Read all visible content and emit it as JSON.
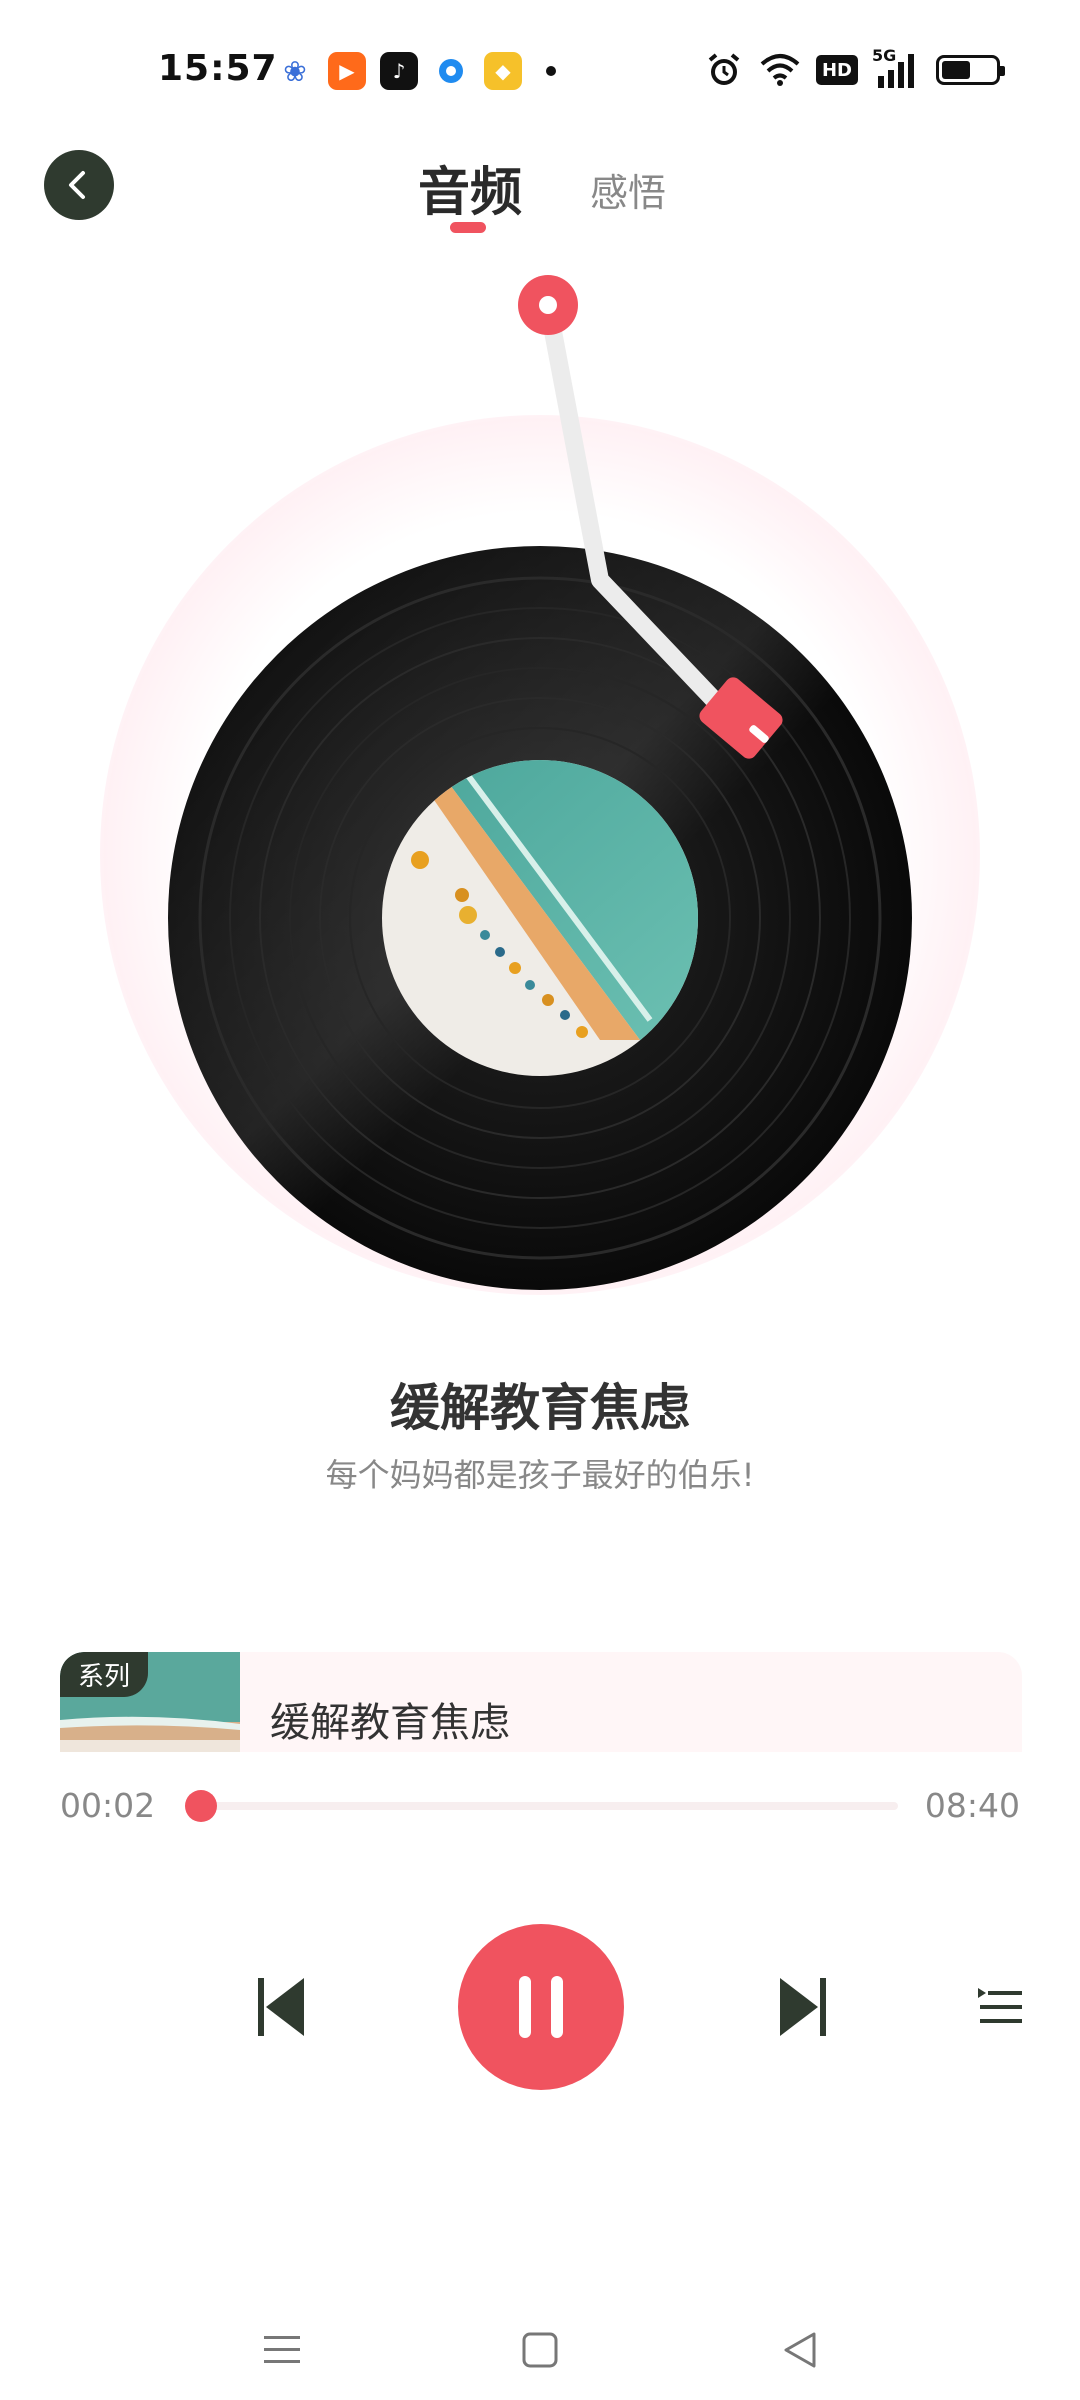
{
  "status_bar": {
    "time": "15:57",
    "network": "5G",
    "hd_label": "HD",
    "battery_level": 0.55
  },
  "header": {
    "tabs": [
      {
        "label": "音频",
        "active": true
      },
      {
        "label": "感悟",
        "active": false
      }
    ]
  },
  "track": {
    "title": "缓解教育焦虑",
    "subtitle": "每个妈妈都是孩子最好的伯乐!"
  },
  "series": {
    "tag": "系列",
    "name": "缓解教育焦虑"
  },
  "progress": {
    "current": "00:02",
    "total": "08:40",
    "fraction": 0.004
  },
  "colors": {
    "accent": "#f0535f",
    "dark": "#2f3a2f"
  }
}
